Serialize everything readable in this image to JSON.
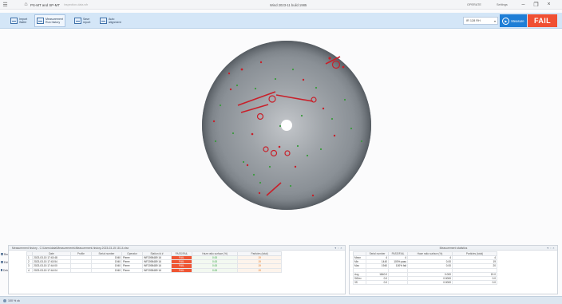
{
  "titlebar": {
    "app_name": "PS-MT and SP-MT",
    "subtitle": "inspection-data.wfr",
    "center_title": "Wind 2023-11 build 1985",
    "status_label": "OPERATE",
    "settings_label": "Settings"
  },
  "ribbon": {
    "buttons": [
      {
        "label": "Import\nWafer"
      },
      {
        "label": "Measurement\nRun history"
      },
      {
        "label": "Save\nreport"
      },
      {
        "label": "Auto\nalignment"
      }
    ],
    "wavelength_select": "IR 128 RH",
    "measure_label": "Measure",
    "result_label": "FAIL"
  },
  "history": {
    "title": "Measurement history - C:\\Users\\data\\Measurements\\Measurement-history-2023-03-15 18.14.xlsx",
    "columns": [
      "",
      "Date",
      "Profile",
      "Serial number",
      "Operator",
      "Station id #",
      "PASS/FAIL",
      "Haze ratio surface (%)",
      "Particles (total)"
    ],
    "rows": [
      [
        "1",
        "2023-03-15 17:43:48",
        "",
        "1940",
        "Pierre",
        "WF2098489 16",
        "FAIL",
        "0.00",
        "19"
      ],
      [
        "2",
        "2023-03-15 17:43:54",
        "",
        "1940",
        "Pierre",
        "WF2098489 16",
        "FAIL",
        "0.00",
        "19"
      ],
      [
        "3",
        "2023-03-15 17:44:00",
        "",
        "1940",
        "Pierre",
        "WF2098489 16",
        "FAIL",
        "0.00",
        "19"
      ],
      [
        "4",
        "2023-03-15 17:44:04",
        "",
        "1940",
        "Pierre",
        "WF2098489 16",
        "FAIL",
        "0.00",
        "19"
      ]
    ],
    "side_tools": [
      "Rem",
      "Edit",
      "Delete"
    ]
  },
  "statistics": {
    "title": "Measurement statistics",
    "columns": [
      "",
      "Serial number",
      "PASS/FAIL",
      "Haze ratio surface (%)",
      "Particles (total)"
    ],
    "rows": [
      [
        "Mean",
        "4",
        "4",
        "4",
        "4"
      ],
      [
        "Min",
        "1440",
        "100% pass",
        "0.00",
        "19"
      ],
      [
        "Max",
        "1940",
        "100% fail",
        "0.00",
        "20"
      ],
      [
        "",
        "",
        "",
        "",
        ""
      ],
      [
        "Avg",
        "1840.0",
        "",
        "0.000",
        "19.0"
      ],
      [
        "StDev",
        "0.0",
        "",
        "0.0000",
        "0.0"
      ],
      [
        "3S",
        "0.0",
        "",
        "0.0000",
        "0.0"
      ]
    ]
  },
  "statusbar": {
    "text": "100 % ok"
  },
  "colors": {
    "accent": "#1e7ed6",
    "fail": "#f05033",
    "ribbon": "#d4e6f7",
    "defect_red": "#c8202a",
    "defect_green": "#3a9a3c"
  }
}
